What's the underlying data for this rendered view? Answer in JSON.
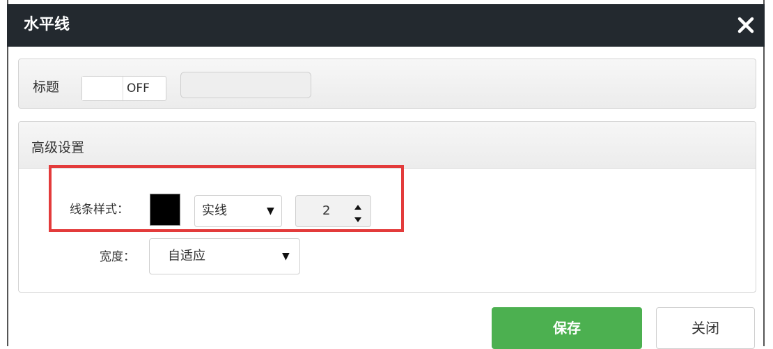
{
  "dialog": {
    "title": "水平线",
    "close_icon": "close-icon"
  },
  "title_row": {
    "label": "标题",
    "toggle_state": "OFF",
    "input_value": ""
  },
  "advanced": {
    "header": "高级设置",
    "line_style_label": "线条样式：",
    "line_color": "#000000",
    "line_type_value": "实线",
    "line_width_value": "2",
    "width_label": "宽度：",
    "width_value": "自适应"
  },
  "footer": {
    "save_label": "保存",
    "close_label": "关闭"
  },
  "colors": {
    "titlebar": "#23292f",
    "save_button": "#4cb050",
    "highlight": "#e33b3b"
  }
}
